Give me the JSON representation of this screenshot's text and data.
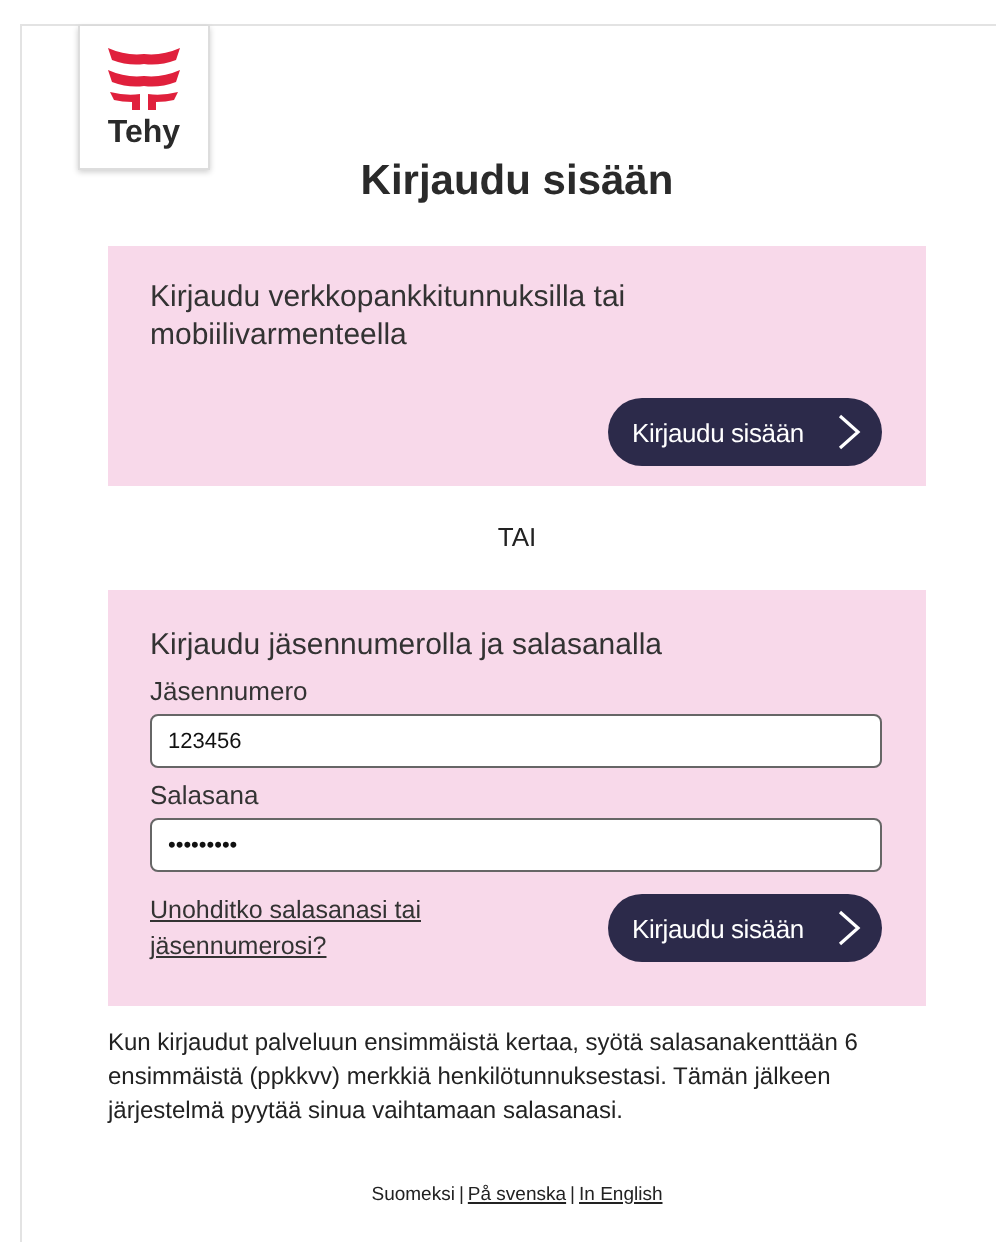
{
  "logo": {
    "text": "Tehy"
  },
  "title": "Kirjaudu sisään",
  "bank_login": {
    "heading": "Kirjaudu verkkopankkitunnuksilla tai mobiilivarmenteella",
    "button": "Kirjaudu sisään"
  },
  "divider_text": "TAI",
  "member_login": {
    "heading": "Kirjaudu jäsennumerolla ja salasanalla",
    "fields": [
      {
        "label": "Jäsennumero",
        "value": "123456"
      },
      {
        "label": "Salasana",
        "value": "•••••••••"
      }
    ],
    "forgot_link": "Unohditko salasanasi tai jäsennumerosi?",
    "button": "Kirjaudu sisään"
  },
  "info_text": "Kun kirjaudut palveluun ensimmäistä kertaa, syötä salasanakenttään 6 ensimmäistä (ppkkvv) merkkiä henkilötunnuksestasi. Tämän jälkeen järjestelmä pyytää sinua vaihtamaan salasanasi.",
  "languages": [
    {
      "label": "Suomeksi",
      "selected": true
    },
    {
      "label": "|",
      "kind": "separator"
    },
    {
      "label": "På svenska",
      "selected": false
    },
    {
      "label": "|",
      "kind": "separator"
    },
    {
      "label": "In English",
      "selected": false
    }
  ]
}
